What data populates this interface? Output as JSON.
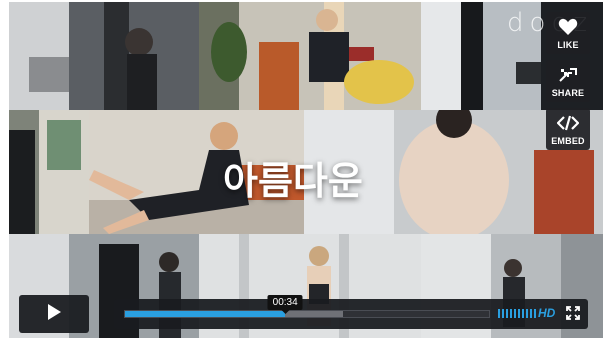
{
  "logo": {
    "text": "dooz"
  },
  "title_overlay": "아름다운",
  "side_actions": [
    {
      "id": "like",
      "label": "LIKE",
      "icon": "heart-icon"
    },
    {
      "id": "share",
      "label": "SHARE",
      "icon": "share-icon"
    },
    {
      "id": "embed",
      "label": "EMBED",
      "icon": "code-icon"
    }
  ],
  "controls": {
    "play_icon": "play-icon",
    "time": "00:34",
    "progress_played": 0.44,
    "progress_loaded": 0.6,
    "volume_bars": 10,
    "hd_label": "HD",
    "fullscreen_icon": "fullscreen-icon"
  },
  "colors": {
    "accent": "#2a9fe0",
    "panel": "#1a1c20"
  }
}
